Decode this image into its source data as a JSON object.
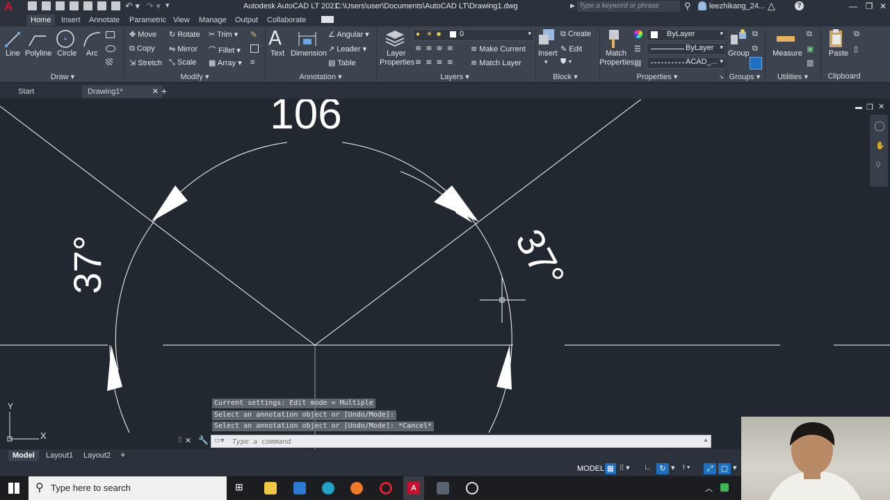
{
  "app": {
    "title": "Autodesk AutoCAD LT 2021",
    "file_path": "C:\\Users\\user\\Documents\\AutoCAD LT\\Drawing1.dwg",
    "search_placeholder": "Type a keyword or phrase",
    "user": "leezhikang_24...",
    "logo_letter": "A"
  },
  "ribbon_tabs": [
    "Home",
    "Insert",
    "Annotate",
    "Parametric",
    "View",
    "Manage",
    "Output",
    "Collaborate"
  ],
  "ribbon": {
    "draw": {
      "panel": "Draw",
      "line": "Line",
      "polyline": "Polyline",
      "circle": "Circle",
      "arc": "Arc"
    },
    "modify": {
      "panel": "Modify",
      "move": "Move",
      "rotate": "Rotate",
      "trim": "Trim",
      "copy": "Copy",
      "mirror": "Mirror",
      "fillet": "Fillet",
      "stretch": "Stretch",
      "scale": "Scale",
      "array": "Array"
    },
    "annotation": {
      "panel": "Annotation",
      "text": "Text",
      "dimension": "Dimension",
      "angular": "Angular",
      "leader": "Leader",
      "table": "Table"
    },
    "layers": {
      "panel": "Layers",
      "layer_properties_1": "Layer",
      "layer_properties_2": "Properties",
      "current_layer": "0",
      "make_current": "Make Current",
      "match_layer": "Match Layer"
    },
    "block": {
      "panel": "Block",
      "insert": "Insert",
      "create": "Create",
      "edit": "Edit"
    },
    "properties": {
      "panel": "Properties",
      "match_1": "Match",
      "match_2": "Properties",
      "color": "ByLayer",
      "linetype": "ByLayer",
      "lineweight": "ACAD_..."
    },
    "groups": {
      "panel": "Groups",
      "group": "Group"
    },
    "utilities": {
      "panel": "Utilities",
      "measure": "Measure"
    },
    "clipboard": {
      "panel": "Clipboard",
      "paste": "Paste"
    }
  },
  "file_tabs": {
    "start": "Start",
    "drawing": "Drawing1*"
  },
  "drawing": {
    "dim_top": "106",
    "dim_left": "37°",
    "dim_right": "37°",
    "ucs_x": "X",
    "ucs_y": "Y"
  },
  "command": {
    "history": [
      "Current settings: Edit mode = Multiple",
      "Select an annotation object or [Undo/Mode]:",
      "Select an annotation object or [Undo/Mode]: *Cancel*"
    ],
    "placeholder": "Type a command"
  },
  "layout_tabs": [
    "Model",
    "Layout1",
    "Layout2"
  ],
  "status": {
    "model": "MODEL"
  },
  "taskbar": {
    "search": "Type here to search"
  },
  "colors": {
    "accent": "#1e6fc0",
    "background": "#212830",
    "ribbon": "#3b444f",
    "logo": "#c8102e"
  }
}
